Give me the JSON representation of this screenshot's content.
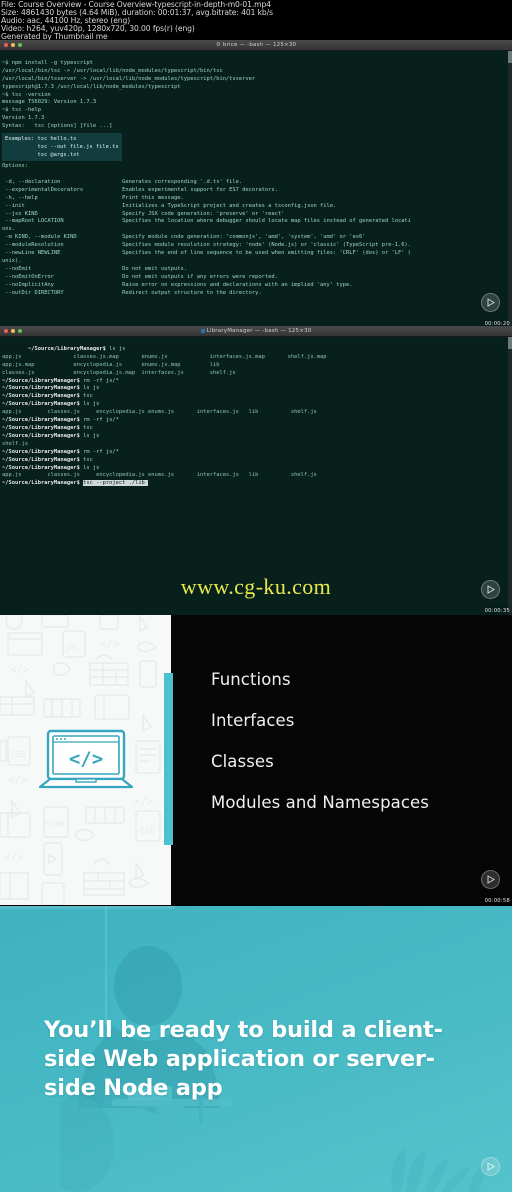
{
  "meta": {
    "line1": "File: Course Overview - Course Overview-typescript-in-depth-m0-01.mp4",
    "line2": "Size: 4861430 bytes (4.64 MiB), duration: 00:01:37, avg.bitrate: 401 kb/s",
    "line3": "Audio: aac, 44100 Hz, stereo (eng)",
    "line4": "Video: h264, yuv420p, 1280x720, 30.00 fps(r) (eng)",
    "line5": "Generated by Thumbnail me"
  },
  "watermark": "www.cg-ku.com",
  "shot1": {
    "title": "brice — -bash — 125×30",
    "timecode": "00:00:20",
    "lines": [
      "~$ npm install -g typescript",
      "/usr/local/bin/tsc -> /usr/local/lib/node_modules/typescript/bin/tsc",
      "/usr/local/bin/tsserver -> /usr/local/lib/node_modules/typescript/bin/tsserver",
      "typescript@1.7.3 /usr/local/lib/node_modules/typescript",
      "~$ tsc -version",
      "message TS6029: Version 1.7.3",
      "~$ tsc -help",
      "Version 1.7.3",
      "Syntax:   tsc [options] [file ...]"
    ],
    "examples": [
      "Examples: tsc hello.ts",
      "          tsc --out file.js file.ts",
      "          tsc @args.txt"
    ],
    "options_header": "Options:",
    "options": [
      {
        "flag": " -d, --declaration",
        "desc": "Generates corresponding '.d.ts' file."
      },
      {
        "flag": " --experimentalDecorators",
        "desc": "Enables experimental support for ES7 decorators."
      },
      {
        "flag": " -h, --help",
        "desc": "Print this message."
      },
      {
        "flag": " --init",
        "desc": "Initializes a TypeScript project and creates a tsconfig.json file."
      },
      {
        "flag": " --jsx KIND",
        "desc": "Specify JSX code generation: 'preserve' or 'react'"
      },
      {
        "flag": " --mapRoot LOCATION",
        "desc": "Specifies the location where debugger should locate map files instead of generated locati"
      },
      {
        "flag": "ons.",
        "desc": ""
      },
      {
        "flag": " -m KIND, --module KIND",
        "desc": "Specify module code generation: 'commonjs', 'amd', 'system', 'umd' or 'es6'"
      },
      {
        "flag": " --moduleResolution",
        "desc": "Specifies module resolution strategy: 'node' (Node.js) or 'classic' (TypeScript pre-1.6)."
      },
      {
        "flag": " --newLine NEWLINE",
        "desc": "Specifies the end of line sequence to be used when emitting files: 'CRLF' (dos) or 'LF' ("
      },
      {
        "flag": "unix).",
        "desc": ""
      },
      {
        "flag": " --noEmit",
        "desc": "Do not emit outputs."
      },
      {
        "flag": " --noEmitOnError",
        "desc": "Do not emit outputs if any errors were reported."
      },
      {
        "flag": " --noImplicitAny",
        "desc": "Raise error on expressions and declarations with an implied 'any' type."
      },
      {
        "flag": " --outDir DIRECTORY",
        "desc": "Redirect output structure to the directory."
      }
    ]
  },
  "shot2": {
    "title": "LibraryManager — -bash — 125×30",
    "timecode": "00:00:35",
    "prompt": "~/Source/LibraryManager$ ",
    "lines": [
      {
        "type": "cmd",
        "text": "ls js"
      },
      {
        "type": "out",
        "text": "app.js                classes.js.map       enums.js             interfaces.js.map       shelf.js.map"
      },
      {
        "type": "out",
        "text": "app.js.map            encyclopedia.js      enums.js.map         lib"
      },
      {
        "type": "out",
        "text": "classes.js            encyclopedia.js.map  interfaces.js        shelf.js"
      },
      {
        "type": "cmd",
        "text": "rm -rf js/*"
      },
      {
        "type": "cmd",
        "text": "ls js"
      },
      {
        "type": "cmd",
        "text": "tsc"
      },
      {
        "type": "cmd",
        "text": "ls js"
      },
      {
        "type": "out",
        "text": "app.js        classes.js     encyclopedia.js enums.js       interfaces.js   lib          shelf.js"
      },
      {
        "type": "cmd",
        "text": "rm -rf js/*"
      },
      {
        "type": "cmd",
        "text": "tsc"
      },
      {
        "type": "cmd",
        "text": "ls js"
      },
      {
        "type": "out",
        "text": "shelf.js"
      },
      {
        "type": "cmd",
        "text": "rm -rf js/*"
      },
      {
        "type": "cmd",
        "text": "tsc"
      },
      {
        "type": "cmd",
        "text": "ls js"
      },
      {
        "type": "out",
        "text": "app.js        classes.js     encyclopedia.js enums.js       interfaces.js   lib          shelf.js"
      }
    ],
    "active_command": "tsc --project ./lib"
  },
  "shot3": {
    "timecode": "00:00:58",
    "bullets": [
      "Functions",
      "Interfaces",
      "Classes",
      "Modules and Namespaces"
    ],
    "accent_color": "#4cc0d0",
    "illustration_label_jpg": "JPG",
    "illustration_label_css": "CSS",
    "illustration_label_html": "HTML",
    "illustration_label_exe": "EXE",
    "illustration_code": "</>"
  },
  "shot4": {
    "text": "You’ll be ready to build a client-side Web application or server-side Node app",
    "background_color": "#46b9c5"
  }
}
